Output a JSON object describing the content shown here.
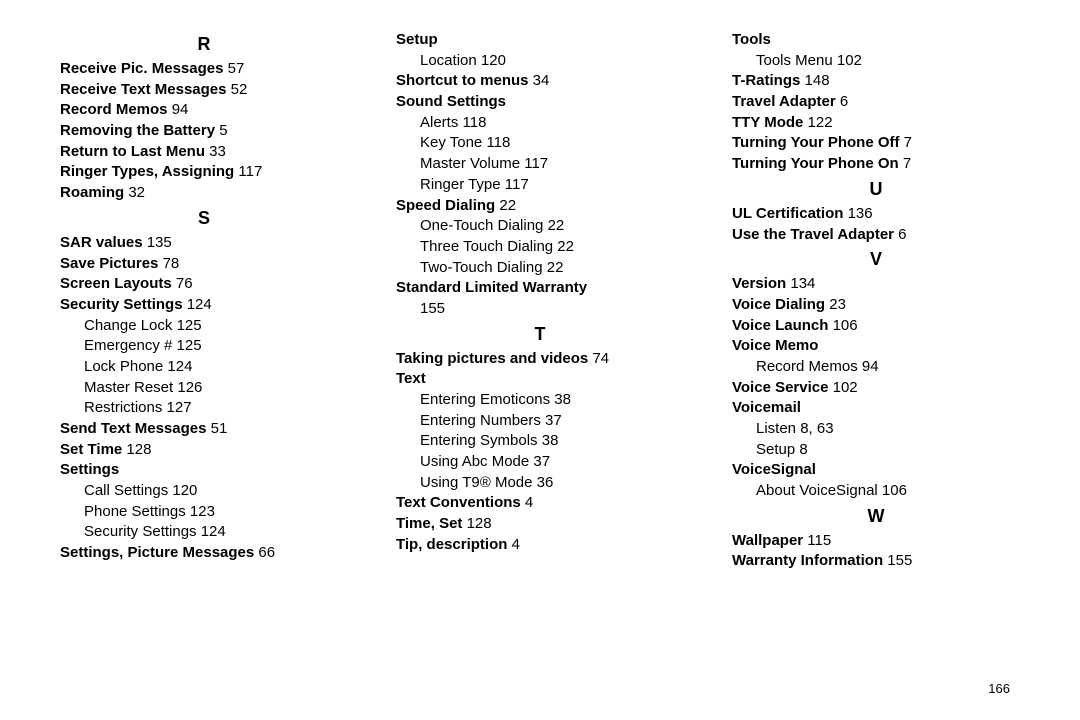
{
  "pageNumber": "166",
  "columns": [
    [
      {
        "type": "letter",
        "text": "R"
      },
      {
        "type": "entry",
        "topic": "Receive Pic. Messages",
        "page": "57"
      },
      {
        "type": "entry",
        "topic": "Receive Text Messages",
        "page": "52"
      },
      {
        "type": "entry",
        "topic": "Record Memos",
        "page": "94"
      },
      {
        "type": "entry",
        "topic": "Removing the Battery",
        "page": "5"
      },
      {
        "type": "entry",
        "topic": "Return to Last Menu",
        "page": "33"
      },
      {
        "type": "entry",
        "topic": "Ringer Types, Assigning",
        "page": "117"
      },
      {
        "type": "entry",
        "topic": "Roaming",
        "page": "32"
      },
      {
        "type": "letter",
        "text": "S"
      },
      {
        "type": "entry",
        "topic": "SAR values",
        "page": "135"
      },
      {
        "type": "entry",
        "topic": "Save Pictures",
        "page": "78"
      },
      {
        "type": "entry",
        "topic": "Screen Layouts",
        "page": "76"
      },
      {
        "type": "entry",
        "topic": "Security Settings",
        "page": "124"
      },
      {
        "type": "sub",
        "text": "Change Lock",
        "page": "125"
      },
      {
        "type": "sub",
        "text": "Emergency #",
        "page": "125"
      },
      {
        "type": "sub",
        "text": "Lock Phone",
        "page": "124"
      },
      {
        "type": "sub",
        "text": "Master Reset",
        "page": "126"
      },
      {
        "type": "sub",
        "text": "Restrictions",
        "page": "127"
      },
      {
        "type": "entry",
        "topic": "Send Text Messages",
        "page": "51"
      },
      {
        "type": "entry",
        "topic": "Set Time",
        "page": "128"
      },
      {
        "type": "entry",
        "topic": "Settings"
      },
      {
        "type": "sub",
        "text": "Call Settings",
        "page": "120"
      },
      {
        "type": "sub",
        "text": "Phone Settings",
        "page": "123"
      },
      {
        "type": "sub",
        "text": "Security Settings",
        "page": "124"
      },
      {
        "type": "entry",
        "topic": "Settings, Picture Messages",
        "page": "66"
      }
    ],
    [
      {
        "type": "entry",
        "topic": "Setup"
      },
      {
        "type": "sub",
        "text": "Location",
        "page": "120"
      },
      {
        "type": "entry",
        "topic": "Shortcut to menus",
        "page": "34"
      },
      {
        "type": "entry",
        "topic": "Sound Settings"
      },
      {
        "type": "sub",
        "text": "Alerts",
        "page": "118"
      },
      {
        "type": "sub",
        "text": "Key Tone",
        "page": "118"
      },
      {
        "type": "sub",
        "text": "Master Volume",
        "page": "117"
      },
      {
        "type": "sub",
        "text": "Ringer Type",
        "page": "117"
      },
      {
        "type": "entry",
        "topic": "Speed Dialing",
        "page": "22"
      },
      {
        "type": "sub",
        "text": "One-Touch Dialing",
        "page": "22"
      },
      {
        "type": "sub",
        "text": "Three Touch Dialing",
        "page": "22"
      },
      {
        "type": "sub",
        "text": "Two-Touch Dialing",
        "page": "22"
      },
      {
        "type": "entry",
        "topic": "Standard Limited Warranty"
      },
      {
        "type": "sub",
        "text": "",
        "page": "155"
      },
      {
        "type": "letter",
        "text": "T"
      },
      {
        "type": "entry",
        "topic": "Taking pictures and videos",
        "page": "74"
      },
      {
        "type": "entry",
        "topic": "Text"
      },
      {
        "type": "sub",
        "text": "Entering Emoticons",
        "page": "38"
      },
      {
        "type": "sub",
        "text": "Entering Numbers",
        "page": "37"
      },
      {
        "type": "sub",
        "text": "Entering Symbols",
        "page": "38"
      },
      {
        "type": "sub",
        "text": "Using Abc Mode",
        "page": "37"
      },
      {
        "type": "sub",
        "text": "Using T9® Mode",
        "page": "36"
      },
      {
        "type": "entry",
        "topic": "Text Conventions",
        "page": "4"
      },
      {
        "type": "entry",
        "topic": "Time, Set",
        "page": "128"
      },
      {
        "type": "entry",
        "topic": "Tip, description",
        "page": "4"
      }
    ],
    [
      {
        "type": "entry",
        "topic": "Tools"
      },
      {
        "type": "sub",
        "text": "Tools Menu",
        "page": "102"
      },
      {
        "type": "entry",
        "topic": "T-Ratings",
        "page": "148"
      },
      {
        "type": "entry",
        "topic": "Travel Adapter",
        "page": "6"
      },
      {
        "type": "entry",
        "topic": "TTY Mode",
        "page": "122"
      },
      {
        "type": "entry",
        "topic": "Turning Your Phone Off",
        "page": "7"
      },
      {
        "type": "entry",
        "topic": "Turning Your Phone On",
        "page": "7"
      },
      {
        "type": "letter",
        "text": "U"
      },
      {
        "type": "entry",
        "topic": "UL Certification",
        "page": "136"
      },
      {
        "type": "entry",
        "topic": "Use the Travel Adapter",
        "page": "6"
      },
      {
        "type": "letter",
        "text": "V"
      },
      {
        "type": "entry",
        "topic": "Version",
        "page": "134"
      },
      {
        "type": "entry",
        "topic": "Voice Dialing",
        "page": "23"
      },
      {
        "type": "entry",
        "topic": "Voice Launch",
        "page": "106"
      },
      {
        "type": "entry",
        "topic": "Voice Memo"
      },
      {
        "type": "sub",
        "text": "Record Memos",
        "page": "94"
      },
      {
        "type": "entry",
        "topic": "Voice Service",
        "page": "102"
      },
      {
        "type": "entry",
        "topic": "Voicemail"
      },
      {
        "type": "sub",
        "text": "Listen",
        "page": "8, 63"
      },
      {
        "type": "sub",
        "text": "Setup",
        "page": "8"
      },
      {
        "type": "entry",
        "topic": "VoiceSignal"
      },
      {
        "type": "sub",
        "text": "About VoiceSignal",
        "page": "106"
      },
      {
        "type": "letter",
        "text": "W"
      },
      {
        "type": "entry",
        "topic": "Wallpaper",
        "page": "115"
      },
      {
        "type": "entry",
        "topic": "Warranty Information",
        "page": "155"
      }
    ]
  ]
}
